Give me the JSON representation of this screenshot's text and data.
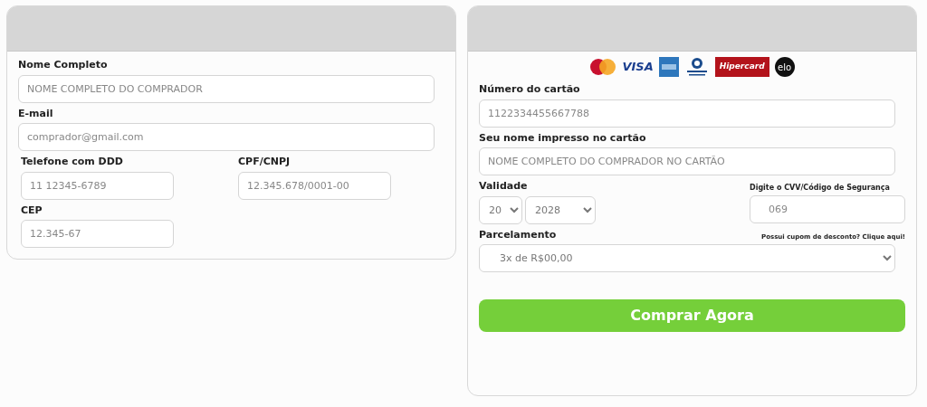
{
  "buyer_form": {
    "fields": [
      {
        "label": "Nome Completo",
        "placeholder": "NOME COMPLETO DO COMPRADOR",
        "kind": "wide"
      },
      {
        "label": "E-mail",
        "placeholder": "comprador@gmail.com",
        "kind": "wide"
      },
      {
        "label": "Telefone com DDD",
        "placeholder": "11 12345-6789",
        "kind": "short"
      },
      {
        "label": "CPF/CNPJ",
        "placeholder": "12.345.678/0001-00",
        "kind": "short"
      },
      {
        "label": "CEP",
        "placeholder": "12.345-67",
        "kind": "short"
      }
    ]
  },
  "payment_form": {
    "card_brands": [
      {
        "kind": "mastercard"
      },
      {
        "kind": "visa",
        "label": "VISA"
      },
      {
        "kind": "amex"
      },
      {
        "kind": "diners"
      },
      {
        "kind": "hipercard",
        "label": "Hipercard"
      },
      {
        "kind": "elo",
        "label": "elo"
      }
    ],
    "card_number": {
      "label": "Número do cartão",
      "placeholder": "1122334455667788"
    },
    "card_name": {
      "label": "Seu nome impresso no cartão",
      "placeholder": "NOME COMPLETO DO COMPRADOR NO CARTÃO"
    },
    "expiry": {
      "label": "Validade",
      "month": "20",
      "year": "2028"
    },
    "cvv": {
      "label": "Digite o CVV/Código de Segurança",
      "placeholder": "069"
    },
    "installments": {
      "label": "Parcelamento",
      "value": "3x de R$00,00"
    },
    "coupon_link": "Possui cupom de desconto? Clique aqui!",
    "submit": "Comprar Agora"
  }
}
